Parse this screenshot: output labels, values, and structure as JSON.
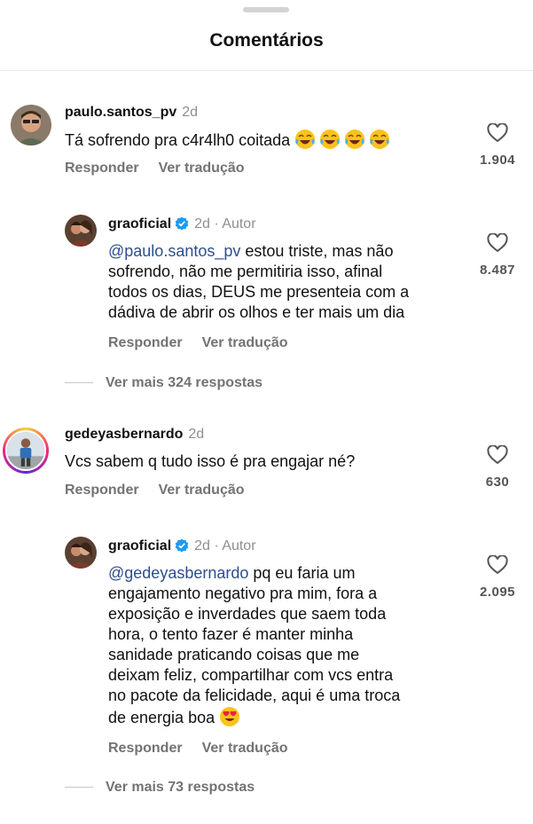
{
  "header": {
    "title": "Comentários"
  },
  "comments": [
    {
      "username": "paulo.santos_pv",
      "time": "2d",
      "text": "Tá sofrendo pra c4r4lh0 coitada",
      "emojis": [
        "face-with-tears-of-joy",
        "face-with-tears-of-joy",
        "face-with-tears-of-joy",
        "face-with-tears-of-joy"
      ],
      "likes": "1.904",
      "reply_label": "Responder",
      "translate_label": "Ver tradução",
      "reply": {
        "username": "graoficial",
        "time": "2d",
        "author_label": "Autor",
        "mention": "@paulo.santos_pv",
        "line1": " estou triste, mas não",
        "line2": "sofrendo, não me permitiria isso, afinal",
        "line3": "todos os dias, DEUS me presenteia com a",
        "line4": "dádiva de abrir os olhos e ter mais um dia",
        "likes": "8.487",
        "reply_label": "Responder",
        "translate_label": "Ver tradução"
      },
      "more_replies": "Ver mais 324 respostas"
    },
    {
      "username": "gedeyasbernardo",
      "time": "2d",
      "text": "Vcs sabem q tudo isso é pra engajar né?",
      "likes": "630",
      "reply_label": "Responder",
      "translate_label": "Ver tradução",
      "reply": {
        "username": "graoficial",
        "time": "2d",
        "author_label": "Autor",
        "mention": "@gedeyasbernardo",
        "line1": " pq eu faria um",
        "line2": "engajamento negativo pra mim, fora a",
        "line3": "exposição e inverdades que saem toda",
        "line4": "hora, o tento fazer é manter minha",
        "line5": "sanidade praticando coisas que me",
        "line6": "deixam feliz, compartilhar com vcs entra",
        "line7": "no pacote da felicidade, aqui é uma troca",
        "line8": "de energia boa",
        "emoji": "smiling-face-with-heart-eyes",
        "likes": "2.095",
        "reply_label": "Responder",
        "translate_label": "Ver tradução"
      },
      "more_replies": "Ver mais 73 respostas"
    }
  ]
}
